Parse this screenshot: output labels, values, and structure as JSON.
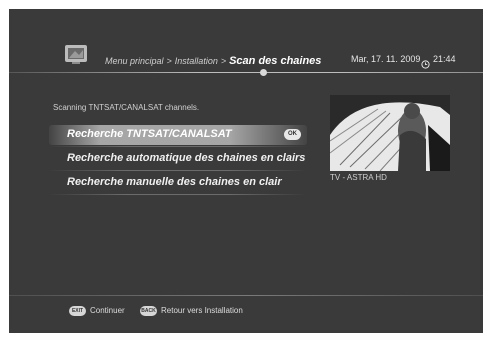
{
  "header": {
    "breadcrumb": [
      "Menu principal",
      "Installation"
    ],
    "separator": ">",
    "current": "Scan des chaines",
    "date": "Mar, 17. 11. 2009",
    "time": "21:44",
    "icons": {
      "app": "tv-icon",
      "clock": "clock-icon"
    }
  },
  "description": "Scanning TNTSAT/CANALSAT channels.",
  "menu": {
    "items": [
      {
        "label": "Recherche TNTSAT/CANALSAT",
        "selected": true,
        "badge": "OK"
      },
      {
        "label": "Recherche automatique des chaines en clairs",
        "selected": false
      },
      {
        "label": "Recherche manuelle des chaines en clair",
        "selected": false
      }
    ]
  },
  "preview": {
    "caption": "TV - ASTRA HD"
  },
  "footer": {
    "buttons": [
      {
        "key": "EXIT",
        "label": "Continuer"
      },
      {
        "key": "BACK",
        "label": "Retour vers Installation"
      }
    ]
  },
  "colors": {
    "background": "#3a3a3a",
    "highlight": "#b0b0b0",
    "text": "#f0f0f0"
  }
}
